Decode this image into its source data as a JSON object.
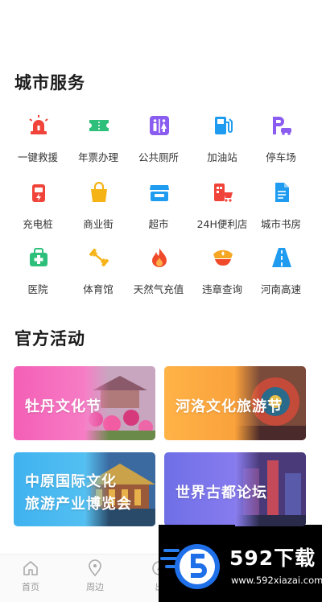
{
  "city_services": {
    "title": "城市服务",
    "items": [
      {
        "label": "一键救援",
        "icon": "siren-icon",
        "color": "#f0443a"
      },
      {
        "label": "年票办理",
        "icon": "ticket-icon",
        "color": "#2ec07a"
      },
      {
        "label": "公共厕所",
        "icon": "restroom-icon",
        "color": "#8a5cf0"
      },
      {
        "label": "加油站",
        "icon": "gas-station-icon",
        "color": "#1f9cf0"
      },
      {
        "label": "停车场",
        "icon": "parking-icon",
        "color": "#8a5cf0"
      },
      {
        "label": "充电桩",
        "icon": "charging-pile-icon",
        "color": "#f0443a"
      },
      {
        "label": "商业街",
        "icon": "shopping-bag-icon",
        "color": "#f5b316"
      },
      {
        "label": "超市",
        "icon": "supermarket-icon",
        "color": "#1f9cf0"
      },
      {
        "label": "24H便利店",
        "icon": "store-cart-icon",
        "color": "#f0443a"
      },
      {
        "label": "城市书房",
        "icon": "document-icon",
        "color": "#1f9cf0"
      },
      {
        "label": "医院",
        "icon": "hospital-icon",
        "color": "#2ec07a"
      },
      {
        "label": "体育馆",
        "icon": "dumbbell-icon",
        "color": "#f5b316"
      },
      {
        "label": "天然气充值",
        "icon": "flame-icon",
        "color": "#f04a2a"
      },
      {
        "label": "违章查询",
        "icon": "police-cap-icon",
        "color": "#f5a623"
      },
      {
        "label": "河南高速",
        "icon": "highway-icon",
        "color": "#1f9cf0"
      }
    ]
  },
  "official_activities": {
    "title": "官方活动",
    "cards": [
      {
        "lines": [
          "牡丹文化节"
        ]
      },
      {
        "lines": [
          "河洛文化旅游节"
        ]
      },
      {
        "lines": [
          "中原国际文化",
          "旅游产业博览会"
        ]
      },
      {
        "lines": [
          "世界古都论坛"
        ]
      }
    ]
  },
  "tabbar": {
    "items": [
      {
        "label": "首页",
        "icon": "home-icon"
      },
      {
        "label": "周边",
        "icon": "location-pin-icon"
      },
      {
        "label": "出",
        "icon": "compass-icon"
      }
    ]
  },
  "watermark": {
    "brand": "592下载",
    "url": "www.592xiazai.com"
  }
}
